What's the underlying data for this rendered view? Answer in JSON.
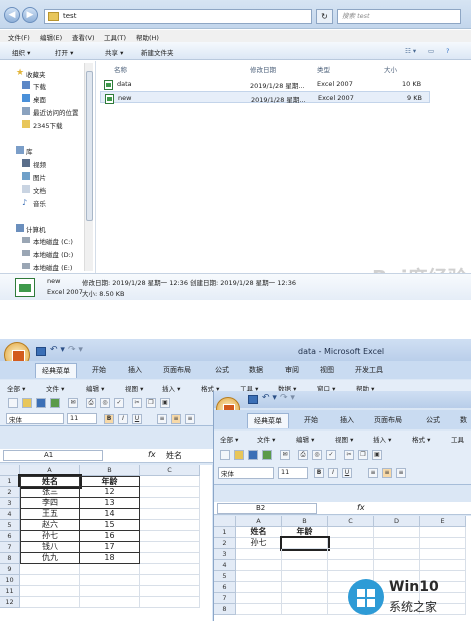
{
  "explorer": {
    "address_path": "test",
    "search_placeholder": "搜索 test",
    "menu": [
      "文件(F)",
      "编辑(E)",
      "查看(V)",
      "工具(T)",
      "帮助(H)"
    ],
    "commands": {
      "organize": "组织 ▾",
      "open": "打开 ▾",
      "share": "共享 ▾",
      "new_folder": "新建文件夹"
    },
    "nav": {
      "favorites_header": "收藏夹",
      "favorites": [
        "下载",
        "桌面",
        "最近访问的位置",
        "2345下载"
      ],
      "libraries_header": "库",
      "libraries": [
        "视频",
        "图片",
        "文档",
        "音乐"
      ],
      "computer_header": "计算机",
      "drives": [
        "本地磁盘 (C:)",
        "本地磁盘 (D:)",
        "本地磁盘 (E:)"
      ]
    },
    "columns": {
      "name": "名称",
      "modified": "修改日期",
      "type": "类型",
      "size": "大小"
    },
    "files": [
      {
        "name": "data",
        "modified": "2019/1/28 星期...",
        "type": "Excel 2007",
        "size": "10 KB"
      },
      {
        "name": "new",
        "modified": "2019/1/28 星期...",
        "type": "Excel 2007",
        "size": "9 KB"
      }
    ],
    "details": {
      "name": "new",
      "type": "Excel 2007",
      "modified": "修改日期: 2019/1/28 星期一 12:36 创建日期: 2019/1/28 星期一 12:36",
      "size": "大小: 8.50 KB"
    },
    "watermark": "Bai度经验"
  },
  "excel1": {
    "title": "data - Microsoft Excel",
    "tabs": [
      "经典菜单",
      "开始",
      "插入",
      "页面布局",
      "公式",
      "数据",
      "审阅",
      "视图",
      "开发工具"
    ],
    "menu": [
      "全部 ▾",
      "文件 ▾",
      "编辑 ▾",
      "视图 ▾",
      "插入 ▾",
      "格式 ▾",
      "工具 ▾",
      "数据 ▾",
      "窗口 ▾",
      "帮助 ▾"
    ],
    "font_name": "宋体",
    "font_size": "11",
    "name_box": "A1",
    "fx": "fx",
    "formula": "姓名",
    "col_headers": [
      "A",
      "B",
      "C"
    ],
    "row_numbers": [
      "1",
      "2",
      "3",
      "4",
      "5",
      "6",
      "7",
      "8",
      "9",
      "10",
      "11",
      "12"
    ],
    "rows": [
      [
        "姓名",
        "年龄"
      ],
      [
        "张三",
        "12"
      ],
      [
        "李四",
        "13"
      ],
      [
        "王五",
        "14"
      ],
      [
        "赵六",
        "15"
      ],
      [
        "孙七",
        "16"
      ],
      [
        "钱八",
        "17"
      ],
      [
        "仇九",
        "18"
      ]
    ]
  },
  "excel2": {
    "tabs": [
      "经典菜单",
      "开始",
      "插入",
      "页面布局",
      "公式",
      "数"
    ],
    "menu": [
      "全部 ▾",
      "文件 ▾",
      "编辑 ▾",
      "视图 ▾",
      "插入 ▾",
      "格式 ▾",
      "工具"
    ],
    "font_name": "宋体",
    "font_size": "11",
    "name_box": "B2",
    "fx": "fx",
    "col_headers": [
      "A",
      "B",
      "C",
      "D",
      "E"
    ],
    "row_numbers": [
      "1",
      "2",
      "3",
      "4",
      "5",
      "6",
      "7",
      "8"
    ],
    "rows": [
      [
        "姓名",
        "年龄"
      ],
      [
        "孙七",
        ""
      ]
    ]
  },
  "brand": {
    "name": "Win10",
    "sub": "系统之家",
    "color": "#2e9bd6"
  }
}
